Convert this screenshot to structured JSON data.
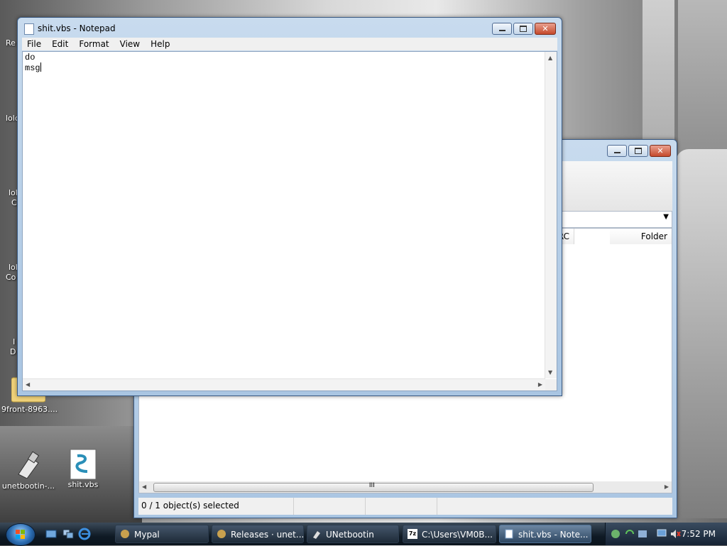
{
  "desktop": {
    "icons": [
      {
        "label": "unetbootin-..."
      },
      {
        "label": "shit.vbs"
      },
      {
        "label": "9front-8963...."
      }
    ],
    "edge_labels": [
      "Re",
      "lolc",
      "lol",
      "C",
      "lol",
      "Co",
      "I",
      "D"
    ]
  },
  "notepad": {
    "title": "shit.vbs - Notepad",
    "menu": [
      "File",
      "Edit",
      "Format",
      "View",
      "Help"
    ],
    "text_lines": [
      "do",
      "msg"
    ]
  },
  "filemgr": {
    "columns": [
      "CRC",
      "Folder"
    ],
    "status": "0 / 1 object(s) selected",
    "scroll_grip": "III"
  },
  "taskbar": {
    "buttons": [
      {
        "label": "Mypal"
      },
      {
        "label": "Releases · unet..."
      },
      {
        "label": "UNetbootin"
      },
      {
        "label": "C:\\Users\\VM0B..."
      },
      {
        "label": "shit.vbs - Note..."
      }
    ],
    "clock": "7:52 PM",
    "app_badge": "7z"
  }
}
